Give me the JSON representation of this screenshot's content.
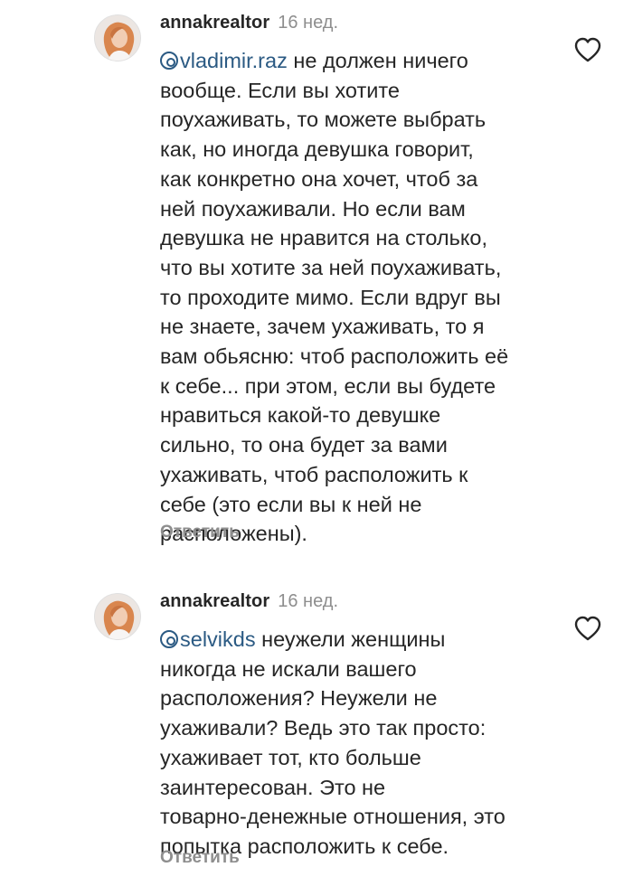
{
  "comments": [
    {
      "username": "annakrealtor",
      "time": "16 нед.",
      "mention": "vladimir.raz",
      "lines": [
        " не должен ничего",
        "вообще. Если вы хотите",
        "поухаживать, то можете выбрать",
        "как, но иногда девушка говорит,",
        "как конкретно она хочет, чтоб за",
        "ней поухаживали. Но если вам",
        "девушка не нравится на столько,",
        "что вы хотите за ней поухаживать,",
        "то проходите мимо. Если вдруг вы",
        "не знаете, зачем ухаживать, то я",
        "вам обьясню: чтоб расположить её",
        "к себе... при этом, если вы будете",
        "нравиться какой-то девушке",
        "сильно, то она будет за вами",
        "ухаживать, чтоб расположить к",
        "себе (это если вы к ней не",
        "расположены)."
      ],
      "reply_label": "Ответить",
      "like_icon": "heart-outline-icon",
      "avatar_icon": "user-avatar"
    },
    {
      "username": "annakrealtor",
      "time": "16 нед.",
      "mention": "selvikds",
      "lines": [
        " неужели женщины",
        "никогда не искали вашего",
        "расположения? Неужели не",
        "ухаживали? Ведь это так просто:",
        "ухаживает тот, кто больше",
        "заинтересован. Это не",
        "товарно-денежные отношения, это",
        "попытка расположить к себе."
      ],
      "reply_label": "Ответить",
      "like_icon": "heart-outline-icon",
      "avatar_icon": "user-avatar"
    }
  ],
  "colors": {
    "text": "#262626",
    "muted": "#8e8e8e",
    "mention": "#2b5a83",
    "background": "#ffffff"
  }
}
